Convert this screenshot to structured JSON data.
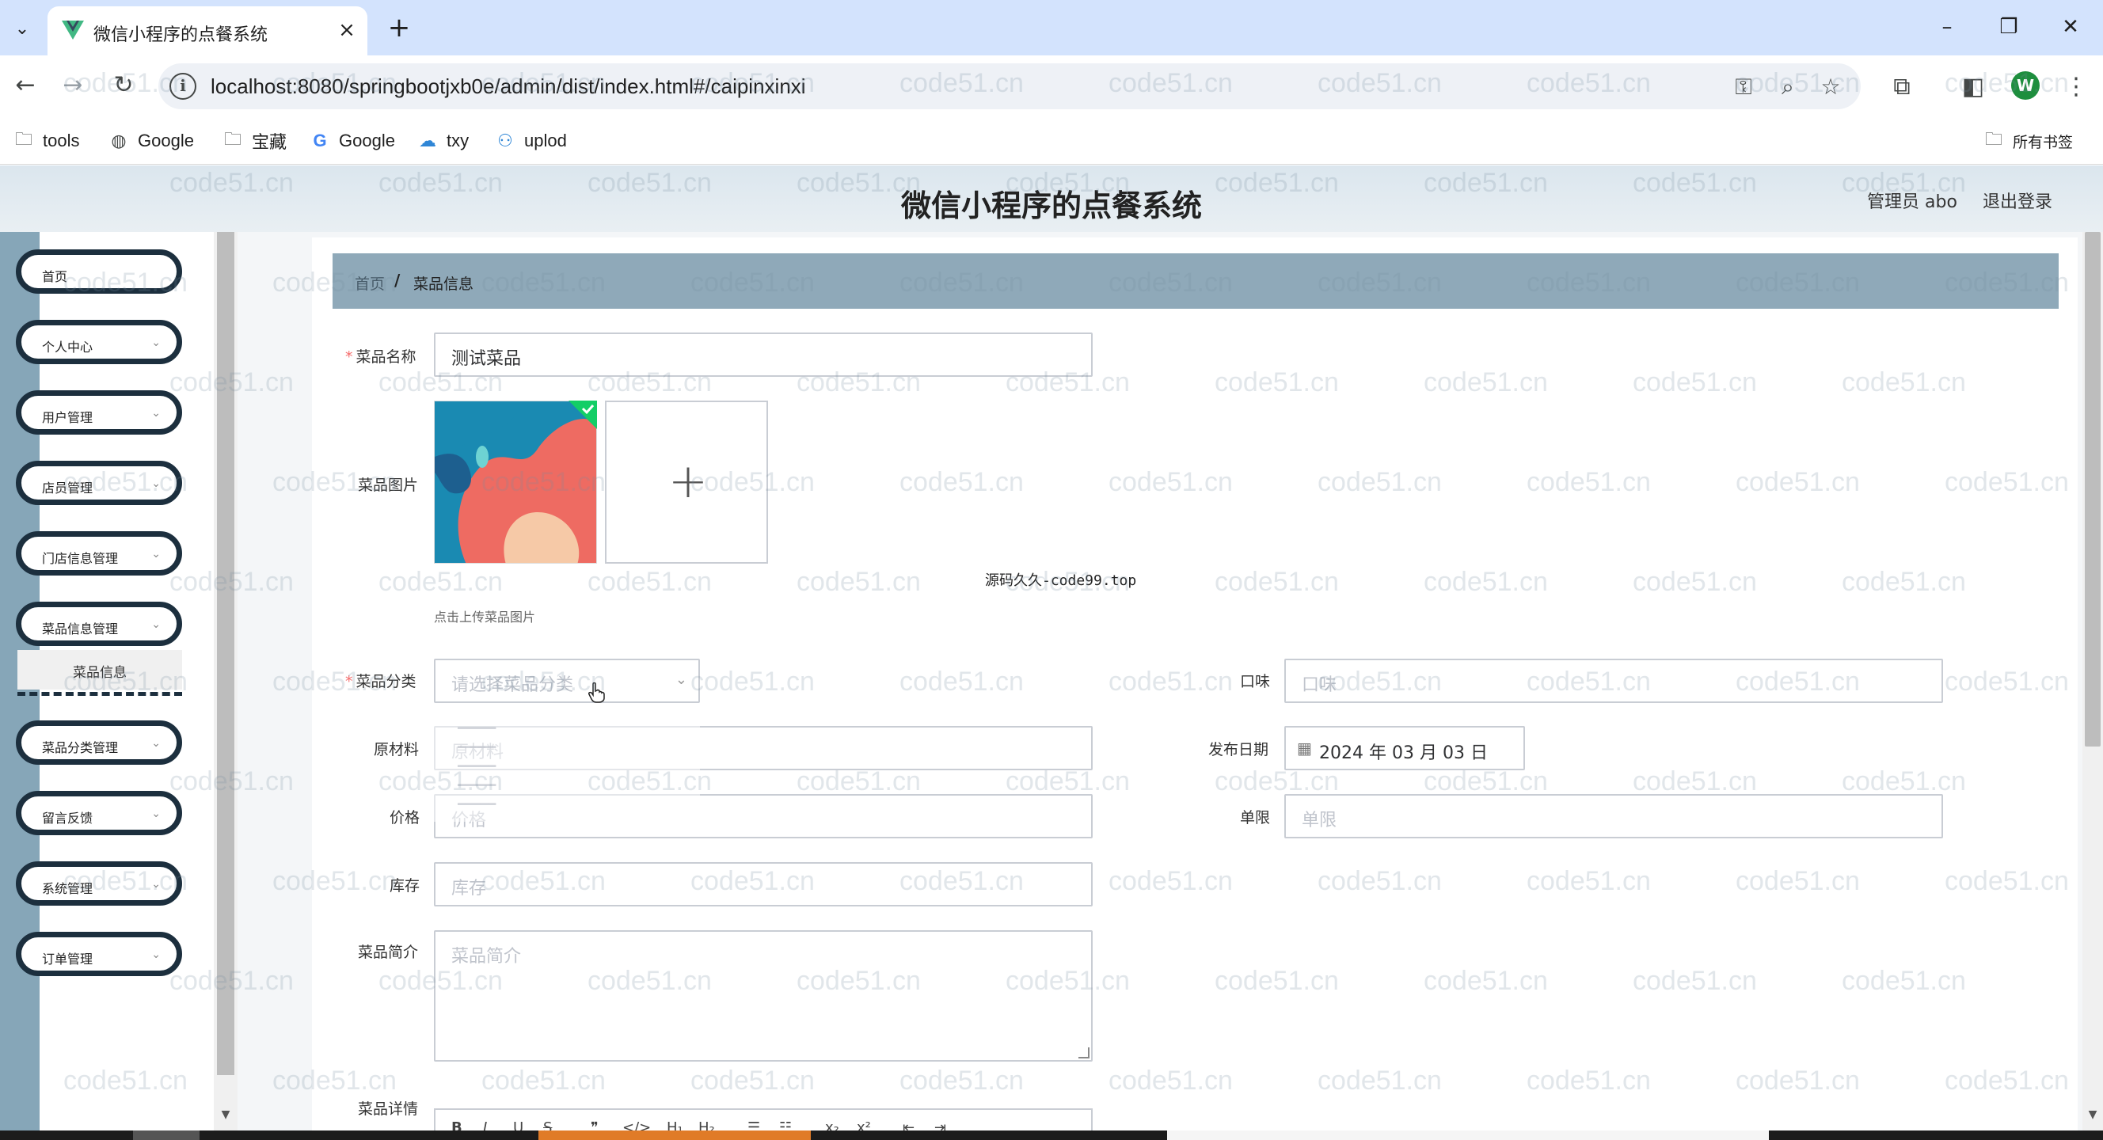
{
  "browser": {
    "tab_title": "微信小程序的点餐系统",
    "url": "localhost:8080/springbootjxb0e/admin/dist/index.html#/caipinxinxi",
    "bookmarks": [
      {
        "label": "tools",
        "icon": "folder-icon"
      },
      {
        "label": "Google",
        "icon": "globe-icon"
      },
      {
        "label": "宝藏",
        "icon": "folder-icon"
      },
      {
        "label": "Google",
        "icon": "google-icon"
      },
      {
        "label": "txy",
        "icon": "cloud-icon"
      },
      {
        "label": "uplod",
        "icon": "people-icon"
      }
    ],
    "all_bookmarks": "所有书签",
    "profile_initial": "W"
  },
  "header": {
    "title": "微信小程序的点餐系统",
    "admin": "管理员 abo",
    "logout": "退出登录"
  },
  "sidebar": {
    "items": [
      {
        "label": "首页",
        "has_arrow": false
      },
      {
        "label": "个人中心",
        "has_arrow": true
      },
      {
        "label": "用户管理",
        "has_arrow": true
      },
      {
        "label": "店员管理",
        "has_arrow": true
      },
      {
        "label": "门店信息管理",
        "has_arrow": true
      },
      {
        "label": "菜品信息管理",
        "has_arrow": true
      },
      {
        "label": "菜品分类管理",
        "has_arrow": true
      },
      {
        "label": "留言反馈",
        "has_arrow": true
      },
      {
        "label": "系统管理",
        "has_arrow": true
      },
      {
        "label": "订单管理",
        "has_arrow": true
      }
    ],
    "submenu_active": "菜品信息"
  },
  "breadcrumb": {
    "home": "首页",
    "separator": "/",
    "current": "菜品信息"
  },
  "form": {
    "name": {
      "label": "菜品名称",
      "value": "测试菜品",
      "required": true
    },
    "image": {
      "label": "菜品图片",
      "hint": "点击上传菜品图片"
    },
    "category": {
      "label": "菜品分类",
      "placeholder": "请选择菜品分类",
      "required": true
    },
    "taste": {
      "label": "口味",
      "placeholder": "口味"
    },
    "ingredients": {
      "label": "原材料",
      "placeholder": "原材料"
    },
    "publish_date": {
      "label": "发布日期",
      "value": "2024 年 03 月 03 日"
    },
    "price": {
      "label": "价格",
      "placeholder": "价格"
    },
    "limit": {
      "label": "单限",
      "placeholder": "单限"
    },
    "stock": {
      "label": "库存",
      "placeholder": "库存"
    },
    "intro": {
      "label": "菜品简介",
      "placeholder": "菜品简介"
    },
    "detail": {
      "label": "菜品详情"
    }
  },
  "source_watermark": "源码久久-code99.top",
  "watermark_text": "code51.cn",
  "colors": {
    "breadcrumb_bg": "#8fa9b9",
    "sidebar_pill_border": "#1c2f3e",
    "required": "#f56c6c",
    "upload_success": "#13ce66"
  }
}
